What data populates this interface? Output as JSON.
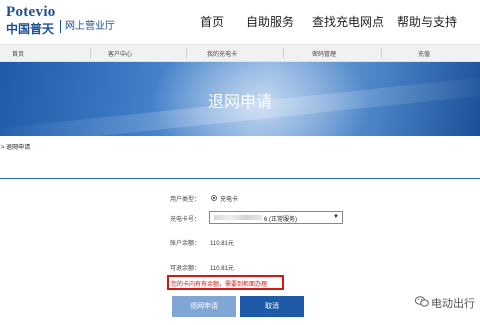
{
  "header": {
    "logo_en": "Potevio",
    "logo_cn": "中国普天",
    "logo_sub": "网上营业厅",
    "nav": [
      "首页",
      "自助服务",
      "查找充电网点",
      "帮助与支持"
    ]
  },
  "subnav": [
    "首页",
    "客户中心",
    "我的充电卡",
    "密码管理",
    "充值"
  ],
  "banner": {
    "title": "退网申请"
  },
  "breadcrumb": "> 退网申请",
  "form": {
    "user_type_label": "用户类型：",
    "user_type_value": "充电卡",
    "card_no_label": "充电卡号：",
    "card_no_value": "6 (正常服务)",
    "balance_label": "账户余额：",
    "balance_value": "110.81元",
    "refundable_label": "可退余额：",
    "refundable_value": "110.81元",
    "warning": "您的卡内有有余额，需要到柜面办理",
    "apply_button": "退网申请",
    "cancel_button": "取消"
  },
  "watermark": "电动出行",
  "colors": {
    "brand_blue": "#1d4f91",
    "warning_red": "#d21717",
    "button_disabled": "#7fa6d4",
    "button_primary": "#1e5aa8"
  }
}
